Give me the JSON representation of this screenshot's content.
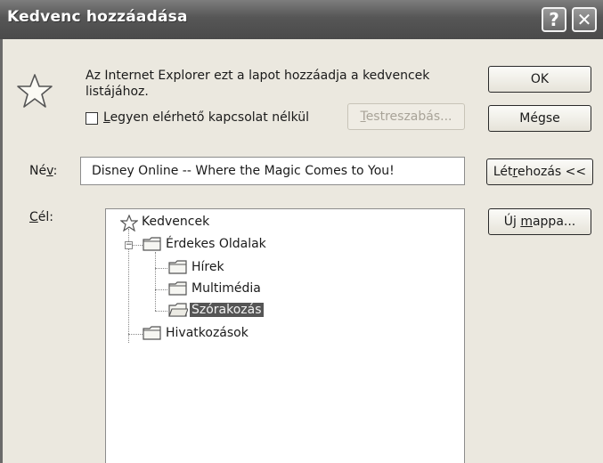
{
  "window": {
    "title": "Kedvenc hozzáadása",
    "help_button": "?",
    "close_button": "✕"
  },
  "description": {
    "line1": "Az Internet Explorer ezt a lapot hozzáadja a kedvencek",
    "line2": "listájához."
  },
  "offline": {
    "checked": false,
    "label_underlined": "L",
    "label_rest": "egyen elérhető kapcsolat nélkül"
  },
  "buttons": {
    "ok": "OK",
    "cancel": "Mégse",
    "customize_underlined": "T",
    "customize_rest": "estreszabás...",
    "create_in_pre": "Lét",
    "create_in_underlined": "r",
    "create_in_post": "ehozás <<",
    "new_folder_pre": "Új ",
    "new_folder_underlined": "m",
    "new_folder_post": "appa..."
  },
  "name": {
    "label_pre": "Né",
    "label_underlined": "v",
    "label_post": ":",
    "value": "Disney Online -- Where the Magic Comes to You!"
  },
  "target": {
    "label_underlined": "C",
    "label_rest": "él:"
  },
  "tree": {
    "root": "Kedvencek",
    "items": [
      {
        "label": "Érdekes Oldalak",
        "expanded": true
      },
      {
        "label": "Hírek"
      },
      {
        "label": "Multimédia"
      },
      {
        "label": "Szórakozás",
        "selected": true
      },
      {
        "label": "Hivatkozások"
      }
    ]
  },
  "icons": {
    "dialog": "favorites-star-icon",
    "root": "star-icon",
    "folder": "folder-icon",
    "expander": "collapse-minus-icon"
  }
}
